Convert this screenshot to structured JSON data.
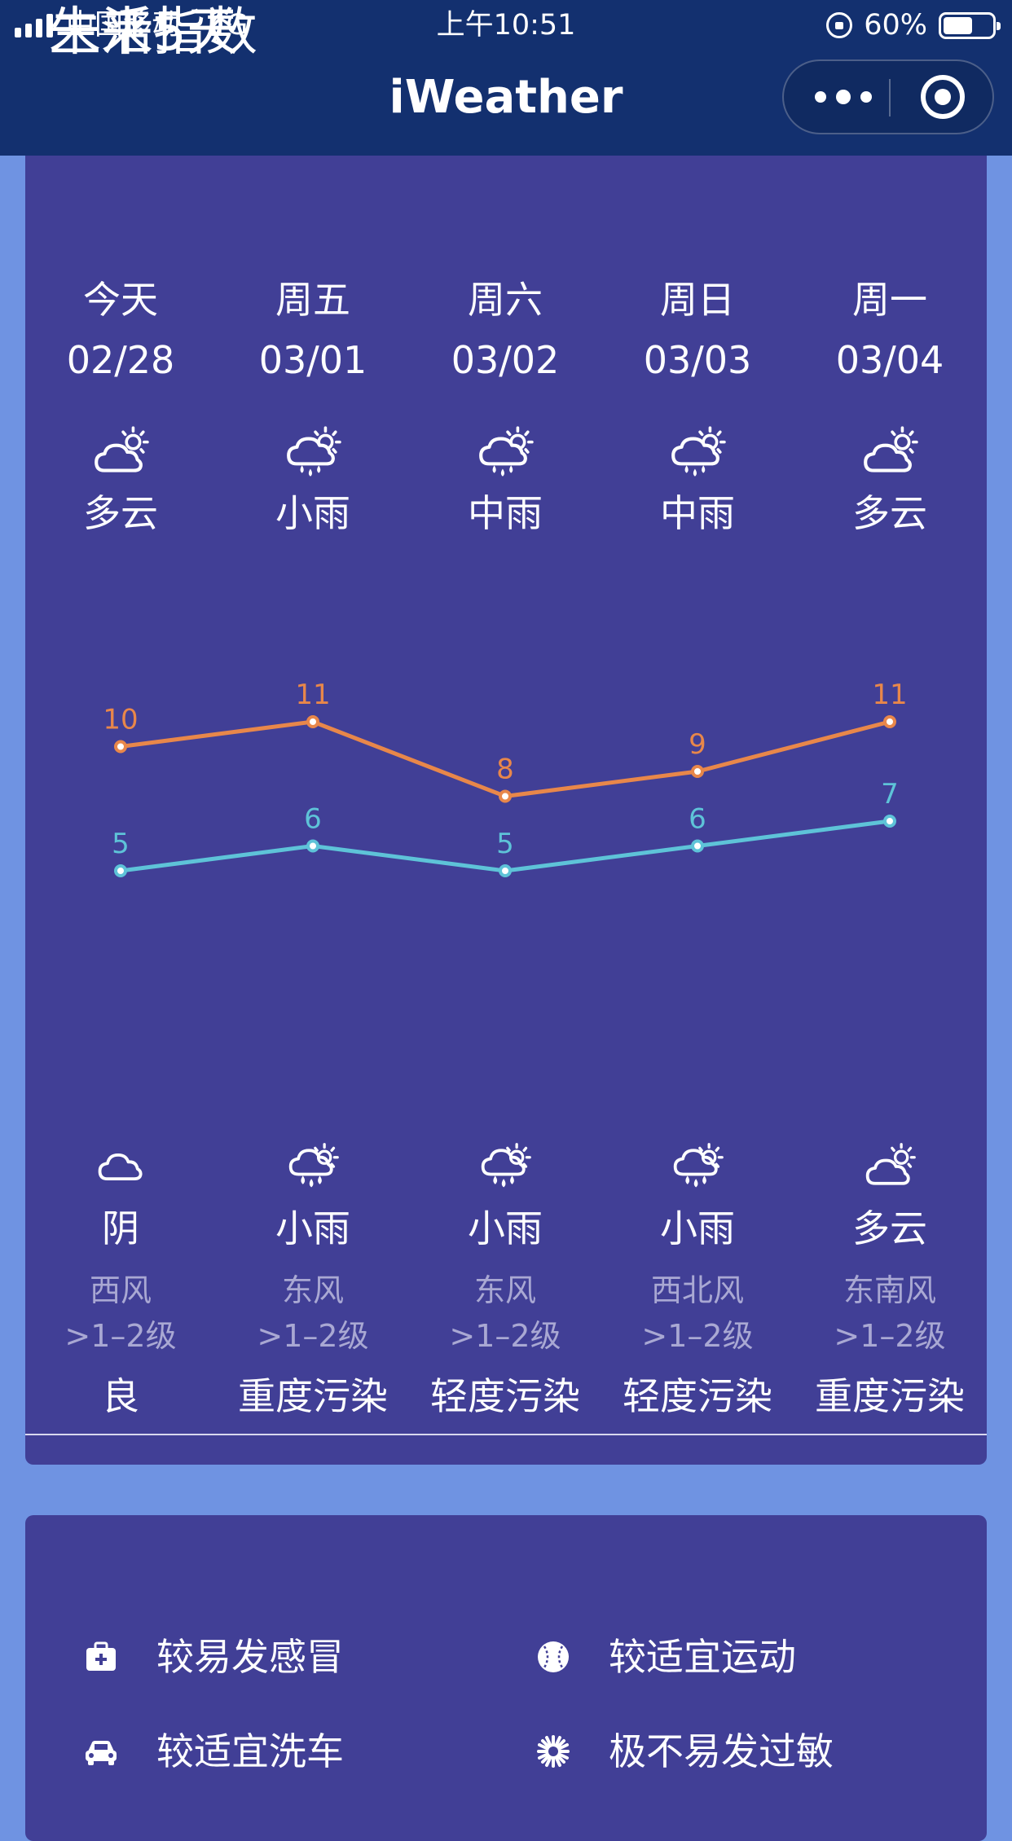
{
  "status": {
    "carrier": "中国移动",
    "network": "4G",
    "time": "上午10:51",
    "battery": "60%",
    "battery_level": 0.6
  },
  "nav": {
    "title": "iWeather"
  },
  "forecast": {
    "title": "未来5天",
    "days": [
      {
        "day": "今天",
        "date": "02/28",
        "day_cond": "多云",
        "day_icon": "cloudy-sun-icon",
        "high": 10,
        "low": 5,
        "night_cond": "阴",
        "night_icon": "cloud-icon",
        "wind_dir": "西风",
        "wind_level": ">1–2级",
        "aqi": "良"
      },
      {
        "day": "周五",
        "date": "03/01",
        "day_cond": "小雨",
        "day_icon": "rain-sun-icon",
        "high": 11,
        "low": 6,
        "night_cond": "小雨",
        "night_icon": "rain-icon",
        "wind_dir": "东风",
        "wind_level": ">1–2级",
        "aqi": "重度污染"
      },
      {
        "day": "周六",
        "date": "03/02",
        "day_cond": "中雨",
        "day_icon": "rain-sun-icon",
        "high": 8,
        "low": 5,
        "night_cond": "小雨",
        "night_icon": "rain-icon",
        "wind_dir": "东风",
        "wind_level": ">1–2级",
        "aqi": "轻度污染"
      },
      {
        "day": "周日",
        "date": "03/03",
        "day_cond": "中雨",
        "day_icon": "rain-sun-icon",
        "high": 9,
        "low": 6,
        "night_cond": "小雨",
        "night_icon": "rain-icon",
        "wind_dir": "西北风",
        "wind_level": ">1–2级",
        "aqi": "轻度污染"
      },
      {
        "day": "周一",
        "date": "03/04",
        "day_cond": "多云",
        "day_icon": "cloudy-sun-icon",
        "high": 11,
        "low": 7,
        "night_cond": "多云",
        "night_icon": "cloudy-sun-icon",
        "wind_dir": "东南风",
        "wind_level": ">1–2级",
        "aqi": "重度污染"
      }
    ]
  },
  "chart_data": {
    "type": "line",
    "categories": [
      "02/28",
      "03/01",
      "03/02",
      "03/03",
      "03/04"
    ],
    "series": [
      {
        "values": [
          10,
          11,
          8,
          9,
          11
        ],
        "color": "#e8874a"
      },
      {
        "values": [
          5,
          6,
          5,
          6,
          7
        ],
        "color": "#5ec3d8"
      }
    ],
    "ylim": [
      0,
      20
    ],
    "grid": false
  },
  "life": {
    "title": "生活指数",
    "items": [
      {
        "text": "较易发感冒",
        "icon": "medkit-icon"
      },
      {
        "text": "较适宜运动",
        "icon": "baseball-icon"
      },
      {
        "text": "较适宜洗车",
        "icon": "car-icon"
      },
      {
        "text": "极不易发过敏",
        "icon": "pollen-icon"
      }
    ]
  },
  "colors": {
    "nav_bg": "#13306f",
    "page_bg": "#6f93e2",
    "card_bg": "#413f96",
    "high_line": "#e8874a",
    "low_line": "#5ec3d8"
  }
}
